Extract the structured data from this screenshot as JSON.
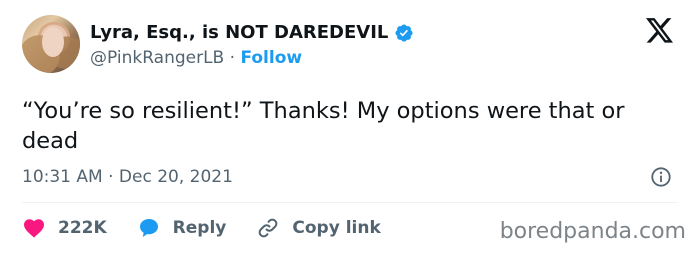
{
  "author": {
    "display_name": "Lyra, Esq., is NOT DAREDEVIL",
    "handle": "@PinkRangerLB",
    "separator": "·",
    "follow_label": "Follow",
    "verified_color": "#1d9bf0"
  },
  "tweet": {
    "text": "“You’re so resilient!” Thanks! My options were that or dead",
    "timestamp": "10:31 AM · Dec 20, 2021"
  },
  "actions": {
    "likes_count": "222K",
    "reply_label": "Reply",
    "copy_link_label": "Copy link"
  },
  "icons": [
    "x-logo-icon",
    "verified-badge-icon",
    "info-icon",
    "heart-icon",
    "reply-bubble-icon",
    "link-icon"
  ],
  "watermark": "boredpanda.com"
}
